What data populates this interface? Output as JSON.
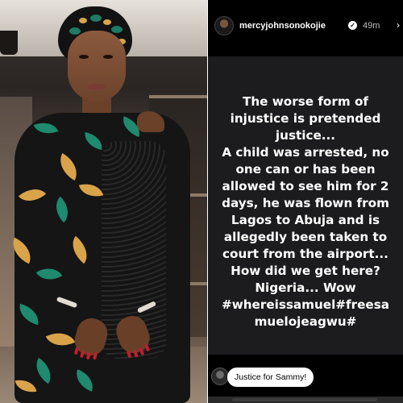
{
  "photo": {
    "alt_subject": "woman-in-ankara-dress"
  },
  "story": {
    "username": "mercyjohnsonokojie",
    "verified_icon": "verified-badge-icon",
    "timestamp": "49m",
    "text": "The worse form of\ninjustice is pretended\njustice...\nA child was arrested, no\none can or has been\nallowed to see him for 2\ndays, he was flown from\nLagos to Abuja and is\nallegedly been taken to\ncourt from the airport...\nHow did we get here?\nNigeria... Wow\n#whereissamuel#freesa\nmuelojeagwu#",
    "reply": "Justice for Sammy!"
  },
  "colors": {
    "story_background": "#000000",
    "card_background": "#1c1c1e",
    "text": "#ffffff",
    "dress_green": "#1f8a6d",
    "dress_gold": "#d9a34a",
    "nail_red": "#c21c2d"
  }
}
